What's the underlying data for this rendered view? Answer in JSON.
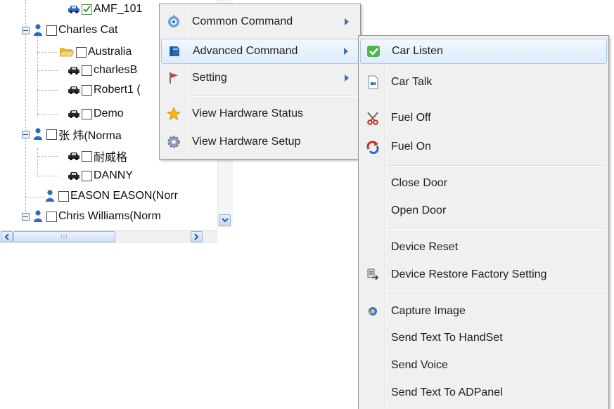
{
  "tree": {
    "nodes": [
      {
        "label": "AMF_101",
        "kind": "vehicle",
        "checked": true
      },
      {
        "label": "Charles Cat",
        "kind": "user",
        "checked": false
      },
      {
        "label": "Australia",
        "kind": "folder",
        "checked": false
      },
      {
        "label": "charlesB",
        "kind": "vehicle",
        "checked": false
      },
      {
        "label": "Robert1 (",
        "kind": "vehicle",
        "checked": false
      },
      {
        "label": "Demo",
        "kind": "vehicle",
        "checked": false
      },
      {
        "label": "张 炜(Norma",
        "kind": "user",
        "checked": false
      },
      {
        "label": "耐威格",
        "kind": "vehicle",
        "checked": false
      },
      {
        "label": "DANNY",
        "kind": "vehicle",
        "checked": false
      },
      {
        "label": "EASON EASON(Norr",
        "kind": "user",
        "checked": false
      },
      {
        "label": "Chris Williams(Norm",
        "kind": "user",
        "checked": false
      }
    ],
    "hscroll_grip": "III"
  },
  "context_menu": {
    "items": [
      {
        "label": "Common Command",
        "icon": "gear-blue-icon",
        "submenu": true
      },
      {
        "label": "Advanced Command",
        "icon": "book-icon",
        "submenu": true,
        "highlighted": true
      },
      {
        "label": "Setting",
        "icon": "flag-icon",
        "submenu": true
      },
      {
        "label": "View Hardware Status",
        "icon": "star-icon",
        "submenu": false
      },
      {
        "label": "View Hardware Setup",
        "icon": "gear-icon",
        "submenu": false
      }
    ]
  },
  "submenu": {
    "items": [
      {
        "label": "Car Listen",
        "icon": "check-green-icon",
        "highlighted": true
      },
      {
        "label": "Car Talk",
        "icon": "document-icon"
      },
      {
        "label": "Fuel Off",
        "icon": "scissors-icon"
      },
      {
        "label": "Fuel On",
        "icon": "refresh-red-icon"
      },
      {
        "label": "Close Door",
        "icon": ""
      },
      {
        "label": "Open Door",
        "icon": ""
      },
      {
        "label": "Device Reset",
        "icon": ""
      },
      {
        "label": "Device Restore Factory Setting",
        "icon": "restore-icon"
      },
      {
        "label": "Capture Image",
        "icon": "camera-icon"
      },
      {
        "label": "Send Text To HandSet",
        "icon": ""
      },
      {
        "label": "Send Voice",
        "icon": ""
      },
      {
        "label": "Send Text To ADPanel",
        "icon": ""
      }
    ]
  },
  "colors": {
    "highlight_border": "#a8c8ee",
    "menu_bg": "#f0f0f0",
    "arrow": "#3d6fb6",
    "user_icon": "#2a6bc2"
  }
}
